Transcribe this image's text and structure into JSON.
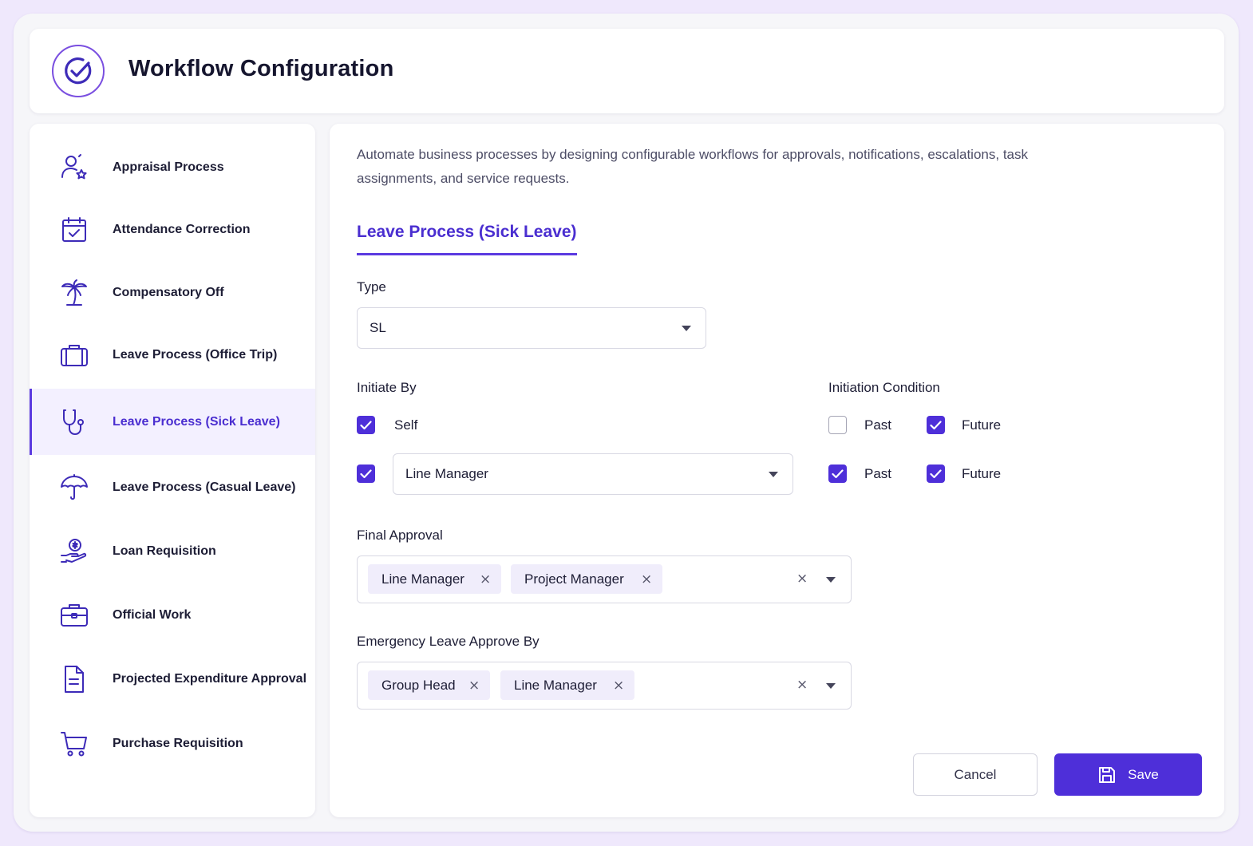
{
  "header": {
    "title": "Workflow Configuration"
  },
  "sidebar": {
    "items": [
      {
        "label": "Appraisal Process",
        "icon": "user-star-icon"
      },
      {
        "label": "Attendance Correction",
        "icon": "calendar-check-icon"
      },
      {
        "label": "Compensatory Off",
        "icon": "palm-tree-icon"
      },
      {
        "label": "Leave Process (Office Trip)",
        "icon": "suitcase-icon"
      },
      {
        "label": "Leave Process (Sick Leave)",
        "icon": "stethoscope-icon",
        "active": true
      },
      {
        "label": "Leave Process (Casual Leave)",
        "icon": "umbrella-icon"
      },
      {
        "label": "Loan Requisition",
        "icon": "hand-coin-icon"
      },
      {
        "label": "Official Work",
        "icon": "briefcase-icon"
      },
      {
        "label": "Projected Expenditure Approval",
        "icon": "document-icon"
      },
      {
        "label": "Purchase Requisition",
        "icon": "cart-icon"
      }
    ]
  },
  "main": {
    "description": "Automate business processes by designing configurable workflows for approvals, notifications, escalations, task assignments, and service requests.",
    "tab": "Leave Process (Sick Leave)",
    "type": {
      "label": "Type",
      "value": "SL"
    },
    "initiate_by": {
      "label": "Initiate By",
      "self_label": "Self",
      "self_checked": true,
      "manager_checked": true,
      "manager_value": "Line Manager"
    },
    "initiation_condition": {
      "label": "Initiation Condition",
      "rows": [
        {
          "past_label": "Past",
          "past": false,
          "future_label": "Future",
          "future": true
        },
        {
          "past_label": "Past",
          "past": true,
          "future_label": "Future",
          "future": true
        }
      ]
    },
    "final_approval": {
      "label": "Final Approval",
      "chips": [
        "Line Manager",
        "Project Manager"
      ]
    },
    "emergency": {
      "label": "Emergency Leave Approve By",
      "chips": [
        "Group Head",
        "Line Manager"
      ]
    },
    "actions": {
      "cancel": "Cancel",
      "save": "Save"
    }
  },
  "colors": {
    "accent": "#4e2fd9",
    "background": "#efe8fc",
    "chip": "#f0edfb"
  }
}
